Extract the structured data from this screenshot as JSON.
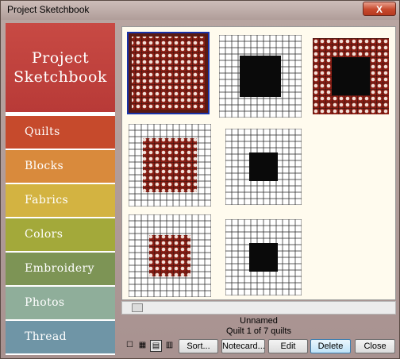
{
  "window": {
    "title": "Project Sketchbook",
    "close_label": "X"
  },
  "brand": {
    "line1": "Project",
    "line2": "Sketchbook"
  },
  "sidebar": {
    "items": [
      {
        "label": "Quilts",
        "color": "#c64a2c"
      },
      {
        "label": "Blocks",
        "color": "#d98a3c"
      },
      {
        "label": "Fabrics",
        "color": "#d3b341"
      },
      {
        "label": "Colors",
        "color": "#a3a93a"
      },
      {
        "label": "Embroidery",
        "color": "#7d9455"
      },
      {
        "label": "Photos",
        "color": "#8fae9a"
      },
      {
        "label": "Thread",
        "color": "#6f95a6"
      }
    ]
  },
  "status": {
    "name": "Unnamed",
    "position": "Quilt 1 of 7 quilts"
  },
  "view_buttons": [
    {
      "name": "large-view-icon",
      "glyph": "☐"
    },
    {
      "name": "medium-view-icon",
      "glyph": "▦"
    },
    {
      "name": "small-view-icon",
      "glyph": "▤"
    },
    {
      "name": "list-view-icon",
      "glyph": "▥"
    }
  ],
  "buttons": {
    "sort": "Sort...",
    "notecard": "Notecard...",
    "edit": "Edit",
    "delete": "Delete",
    "close": "Close"
  }
}
